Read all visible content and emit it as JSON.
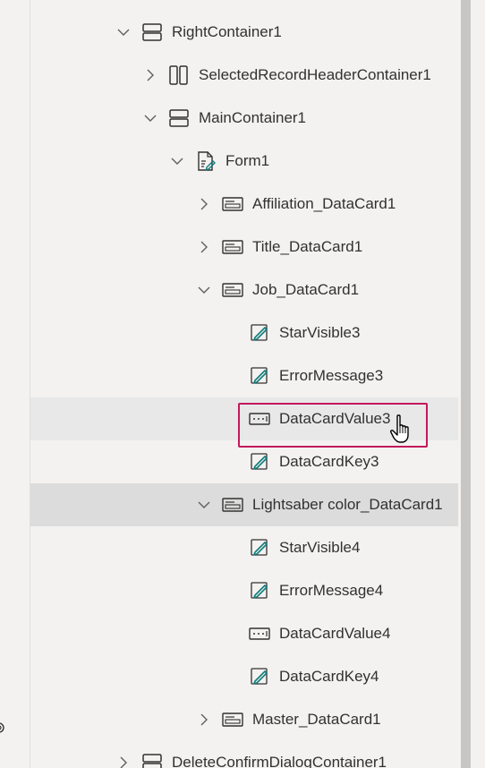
{
  "tree": {
    "rows": [
      {
        "label": "RightContainer1",
        "chevron": "down",
        "icon": "vertical-container-icon"
      },
      {
        "label": "SelectedRecordHeaderContainer1",
        "chevron": "right",
        "icon": "horizontal-container-icon"
      },
      {
        "label": "MainContainer1",
        "chevron": "down",
        "icon": "vertical-container-icon"
      },
      {
        "label": "Form1",
        "chevron": "down",
        "icon": "form-icon"
      },
      {
        "label": "Affiliation_DataCard1",
        "chevron": "right",
        "icon": "datacard-icon"
      },
      {
        "label": "Title_DataCard1",
        "chevron": "right",
        "icon": "datacard-icon"
      },
      {
        "label": "Job_DataCard1",
        "chevron": "down",
        "icon": "datacard-icon"
      },
      {
        "label": "StarVisible3",
        "chevron": "none",
        "icon": "label-edit-icon"
      },
      {
        "label": "ErrorMessage3",
        "chevron": "none",
        "icon": "label-edit-icon"
      },
      {
        "label": "DataCardValue3",
        "chevron": "none",
        "icon": "text-input-icon"
      },
      {
        "label": "DataCardKey3",
        "chevron": "none",
        "icon": "label-edit-icon"
      },
      {
        "label": "Lightsaber color_DataCard1",
        "chevron": "down",
        "icon": "datacard-icon"
      },
      {
        "label": "StarVisible4",
        "chevron": "none",
        "icon": "label-edit-icon"
      },
      {
        "label": "ErrorMessage4",
        "chevron": "none",
        "icon": "label-edit-icon"
      },
      {
        "label": "DataCardValue4",
        "chevron": "none",
        "icon": "text-input-icon"
      },
      {
        "label": "DataCardKey4",
        "chevron": "none",
        "icon": "label-edit-icon"
      },
      {
        "label": "Master_DataCard1",
        "chevron": "right",
        "icon": "datacard-icon"
      },
      {
        "label": "DeleteConfirmDialogContainer1",
        "chevron": "right",
        "icon": "vertical-container-icon"
      }
    ]
  },
  "colors": {
    "accent_teal": "#0f7c7a",
    "highlight_border": "#c3195d"
  }
}
